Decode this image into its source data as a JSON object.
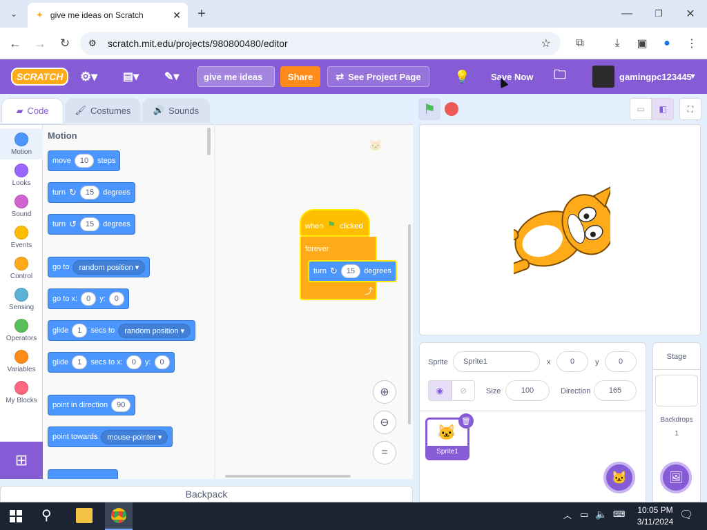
{
  "browser": {
    "tab_title": "give me ideas on Scratch",
    "url": "scratch.mit.edu/projects/980800480/editor",
    "window_controls": [
      "minimize",
      "restore",
      "close"
    ]
  },
  "menubar": {
    "logo": "SCRATCH",
    "project_title": "give me ideas",
    "share_label": "Share",
    "see_project_label": "See Project Page",
    "save_label": "Save Now",
    "username": "gamingpc123445"
  },
  "editor_tabs": {
    "code": "Code",
    "costumes": "Costumes",
    "sounds": "Sounds"
  },
  "categories": [
    {
      "label": "Motion",
      "color": "#4c97ff"
    },
    {
      "label": "Looks",
      "color": "#9966ff"
    },
    {
      "label": "Sound",
      "color": "#cf63cf"
    },
    {
      "label": "Events",
      "color": "#ffbf00"
    },
    {
      "label": "Control",
      "color": "#ffab19"
    },
    {
      "label": "Sensing",
      "color": "#5cb1d6"
    },
    {
      "label": "Operators",
      "color": "#59c059"
    },
    {
      "label": "Variables",
      "color": "#ff8c1a"
    },
    {
      "label": "My Blocks",
      "color": "#ff6680"
    }
  ],
  "palette": {
    "heading": "Motion",
    "move": {
      "a": "move",
      "v": "10",
      "b": "steps"
    },
    "turn_right": {
      "a": "turn",
      "v": "15",
      "b": "degrees"
    },
    "turn_left": {
      "a": "turn",
      "v": "15",
      "b": "degrees"
    },
    "go_to": {
      "a": "go to",
      "opt": "random position"
    },
    "go_to_xy": {
      "a": "go to x:",
      "x": "0",
      "b": "y:",
      "y": "0"
    },
    "glide_to": {
      "a": "glide",
      "v": "1",
      "b": "secs to",
      "opt": "random position"
    },
    "glide_xy": {
      "a": "glide",
      "v": "1",
      "b": "secs to x:",
      "x": "0",
      "c": "y:",
      "y": "0"
    },
    "point_dir": {
      "a": "point in direction",
      "v": "90"
    },
    "point_towards": {
      "a": "point towards",
      "opt": "mouse-pointer"
    }
  },
  "script": {
    "hat_a": "when",
    "hat_b": "clicked",
    "forever": "forever",
    "turn_a": "turn",
    "turn_v": "15",
    "turn_b": "degrees"
  },
  "zoom": {
    "in": "+",
    "out": "−",
    "reset": "="
  },
  "sprite_info": {
    "sprite_label": "Sprite",
    "sprite_name": "Sprite1",
    "x_label": "x",
    "x": "0",
    "y_label": "y",
    "y": "0",
    "size_label": "Size",
    "size": "100",
    "direction_label": "Direction",
    "direction": "165",
    "thumb_name": "Sprite1"
  },
  "stage_panel": {
    "title": "Stage",
    "backdrops_label": "Backdrops",
    "backdrops_count": "1"
  },
  "backpack_label": "Backpack",
  "taskbar": {
    "time": "10:05 PM",
    "date": "3/11/2024"
  }
}
